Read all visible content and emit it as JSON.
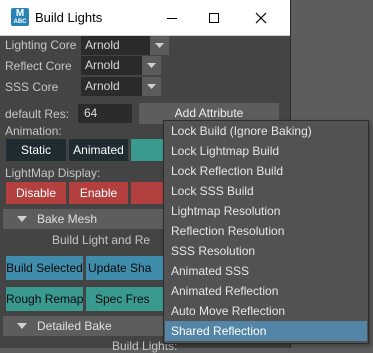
{
  "window": {
    "title": "Build Lights",
    "icon_text_main": "M",
    "icon_text_sub": "ABC",
    "controls": [
      "minimize-icon",
      "maximize-icon",
      "close-icon"
    ]
  },
  "settings": {
    "lighting_core": {
      "label": "Lighting Core",
      "value": "Arnold"
    },
    "reflect_core": {
      "label": "Reflect Core",
      "value": "Arnold"
    },
    "sss_core": {
      "label": "SSS Core",
      "value": "Arnold"
    },
    "default_res": {
      "label": "default Res:",
      "value": "64"
    },
    "add_attribute_label": "Add Attribute"
  },
  "animation": {
    "label": "Animation:",
    "static_label": "Static",
    "animated_label": "Animated"
  },
  "lightmap_display": {
    "label": "LightMap Display:",
    "disable_label": "Disable",
    "enable_label": "Enable"
  },
  "bake_mesh": {
    "header": "Bake Mesh",
    "subtitle": "Build Light and Re",
    "build_selected_label": "Build Selected",
    "update_label": "Update Sha",
    "rough_remap_label": "Rough Remap",
    "spec_label": "Spec Fres"
  },
  "detailed_bake": {
    "header": "Detailed Bake",
    "subtitle": "Build Lights:"
  },
  "menu": {
    "items": [
      "Lock Build (Ignore Baking)",
      "Lock Lightmap Build",
      "Lock Reflection Build",
      "Lock SSS Build",
      "Lightmap Resolution",
      "Reflection Resolution",
      "SSS Resolution",
      "Animated SSS",
      "Animated Reflection",
      "Auto Move Reflection",
      "Shared Reflection"
    ],
    "highlighted_index": 10,
    "highlight_color": "#5285a6"
  },
  "colors": {
    "red_button": "#b33f3f",
    "blue_button": "#3f8dab",
    "teal_button": "#3a9a90",
    "dark_button": "#1f2d33"
  }
}
